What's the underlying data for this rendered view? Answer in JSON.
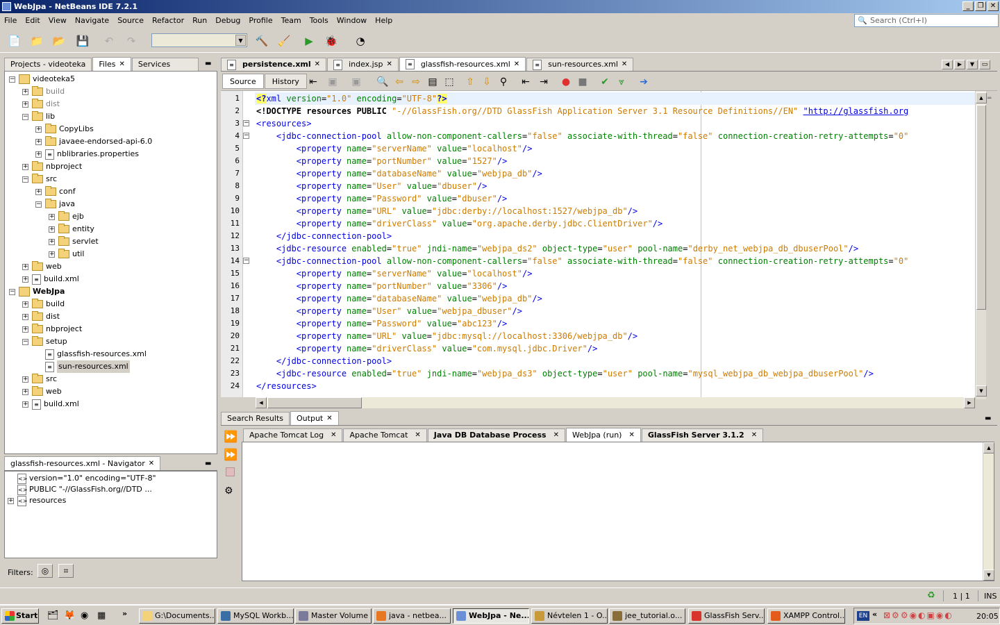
{
  "window": {
    "title": "WebJpa - NetBeans IDE 7.2.1"
  },
  "menu": [
    "File",
    "Edit",
    "View",
    "Navigate",
    "Source",
    "Refactor",
    "Run",
    "Debug",
    "Profile",
    "Team",
    "Tools",
    "Window",
    "Help"
  ],
  "search": {
    "placeholder": "Search (Ctrl+I)"
  },
  "left_tabs": [
    {
      "label": "Projects - videoteka",
      "active": false
    },
    {
      "label": "Files",
      "active": true,
      "closable": true
    },
    {
      "label": "Services",
      "active": false
    }
  ],
  "file_tree": [
    {
      "label": "videoteka5",
      "level": 0,
      "type": "project",
      "expanded": true
    },
    {
      "label": "build",
      "level": 1,
      "type": "folder",
      "gray": true
    },
    {
      "label": "dist",
      "level": 1,
      "type": "folder",
      "gray": true
    },
    {
      "label": "lib",
      "level": 1,
      "type": "folder",
      "expanded": true
    },
    {
      "label": "CopyLibs",
      "level": 2,
      "type": "folder"
    },
    {
      "label": "javaee-endorsed-api-6.0",
      "level": 2,
      "type": "folder"
    },
    {
      "label": "nblibraries.properties",
      "level": 2,
      "type": "file"
    },
    {
      "label": "nbproject",
      "level": 1,
      "type": "folder"
    },
    {
      "label": "src",
      "level": 1,
      "type": "folder",
      "expanded": true
    },
    {
      "label": "conf",
      "level": 2,
      "type": "folder"
    },
    {
      "label": "java",
      "level": 2,
      "type": "folder",
      "expanded": true
    },
    {
      "label": "ejb",
      "level": 3,
      "type": "folder"
    },
    {
      "label": "entity",
      "level": 3,
      "type": "folder"
    },
    {
      "label": "servlet",
      "level": 3,
      "type": "folder"
    },
    {
      "label": "util",
      "level": 3,
      "type": "folder"
    },
    {
      "label": "web",
      "level": 1,
      "type": "folder"
    },
    {
      "label": "build.xml",
      "level": 1,
      "type": "file"
    },
    {
      "label": "WebJpa",
      "level": 0,
      "type": "project",
      "expanded": true,
      "bold": true
    },
    {
      "label": "build",
      "level": 1,
      "type": "folder"
    },
    {
      "label": "dist",
      "level": 1,
      "type": "folder"
    },
    {
      "label": "nbproject",
      "level": 1,
      "type": "folder"
    },
    {
      "label": "setup",
      "level": 1,
      "type": "folder",
      "expanded": true
    },
    {
      "label": "glassfish-resources.xml",
      "level": 2,
      "type": "file",
      "leaf": true
    },
    {
      "label": "sun-resources.xml",
      "level": 2,
      "type": "file",
      "leaf": true,
      "selected": true
    },
    {
      "label": "src",
      "level": 1,
      "type": "folder"
    },
    {
      "label": "web",
      "level": 1,
      "type": "folder"
    },
    {
      "label": "build.xml",
      "level": 1,
      "type": "file"
    }
  ],
  "navigator": {
    "title": "glassfish-resources.xml - Navigator",
    "items": [
      {
        "label": "version=\"1.0\" encoding=\"UTF-8\"",
        "expand": false
      },
      {
        "label": "PUBLIC \"-//GlassFish.org//DTD ...",
        "expand": false
      },
      {
        "label": "resources",
        "expand": true
      }
    ],
    "filters_label": "Filters:"
  },
  "editor_tabs": [
    {
      "label": "persistence.xml",
      "bold": true
    },
    {
      "label": "index.jsp"
    },
    {
      "label": "glassfish-resources.xml",
      "active": true
    },
    {
      "label": "sun-resources.xml"
    }
  ],
  "editor_view_tabs": [
    {
      "label": "Source",
      "active": true
    },
    {
      "label": "History"
    }
  ],
  "code_lines": [
    [
      [
        "pi",
        "<?"
      ],
      [
        "tag",
        "xml "
      ],
      [
        "an",
        "version"
      ],
      [
        "t",
        "="
      ],
      [
        "av",
        "\"1.0\""
      ],
      [
        "t",
        " "
      ],
      [
        "an",
        "encoding"
      ],
      [
        "t",
        "="
      ],
      [
        "av",
        "\"UTF-8\""
      ],
      [
        "pi",
        "?>"
      ]
    ],
    [
      [
        "dt",
        "<!DOCTYPE resources PUBLIC "
      ],
      [
        "av",
        "\"-//GlassFish.org//DTD GlassFish Application Server 3.1 Resource Definitions//EN\""
      ],
      [
        "t",
        " "
      ],
      [
        "av",
        "\"http://glassfish.org"
      ]
    ],
    [
      [
        "tag",
        "<resources>"
      ]
    ],
    [
      [
        "t",
        "    "
      ],
      [
        "tag",
        "<jdbc-connection-pool "
      ],
      [
        "an",
        "allow-non-component-callers"
      ],
      [
        "t",
        "="
      ],
      [
        "av",
        "\"false\""
      ],
      [
        "t",
        " "
      ],
      [
        "an",
        "associate-with-thread"
      ],
      [
        "t",
        "="
      ],
      [
        "av",
        "\"false\""
      ],
      [
        "t",
        " "
      ],
      [
        "an",
        "connection-creation-retry-attempts"
      ],
      [
        "t",
        "="
      ],
      [
        "av",
        "\"0\""
      ]
    ],
    [
      [
        "t",
        "        "
      ],
      [
        "tag",
        "<property "
      ],
      [
        "an",
        "name"
      ],
      [
        "t",
        "="
      ],
      [
        "av",
        "\"serverName\""
      ],
      [
        "t",
        " "
      ],
      [
        "an",
        "value"
      ],
      [
        "t",
        "="
      ],
      [
        "av",
        "\"localhost\""
      ],
      [
        "tag",
        "/>"
      ]
    ],
    [
      [
        "t",
        "        "
      ],
      [
        "tag",
        "<property "
      ],
      [
        "an",
        "name"
      ],
      [
        "t",
        "="
      ],
      [
        "av",
        "\"portNumber\""
      ],
      [
        "t",
        " "
      ],
      [
        "an",
        "value"
      ],
      [
        "t",
        "="
      ],
      [
        "av",
        "\"1527\""
      ],
      [
        "tag",
        "/>"
      ]
    ],
    [
      [
        "t",
        "        "
      ],
      [
        "tag",
        "<property "
      ],
      [
        "an",
        "name"
      ],
      [
        "t",
        "="
      ],
      [
        "av",
        "\"databaseName\""
      ],
      [
        "t",
        " "
      ],
      [
        "an",
        "value"
      ],
      [
        "t",
        "="
      ],
      [
        "av",
        "\"webjpa_db\""
      ],
      [
        "tag",
        "/>"
      ]
    ],
    [
      [
        "t",
        "        "
      ],
      [
        "tag",
        "<property "
      ],
      [
        "an",
        "name"
      ],
      [
        "t",
        "="
      ],
      [
        "av",
        "\"User\""
      ],
      [
        "t",
        " "
      ],
      [
        "an",
        "value"
      ],
      [
        "t",
        "="
      ],
      [
        "av",
        "\"dbuser\""
      ],
      [
        "tag",
        "/>"
      ]
    ],
    [
      [
        "t",
        "        "
      ],
      [
        "tag",
        "<property "
      ],
      [
        "an",
        "name"
      ],
      [
        "t",
        "="
      ],
      [
        "av",
        "\"Password\""
      ],
      [
        "t",
        " "
      ],
      [
        "an",
        "value"
      ],
      [
        "t",
        "="
      ],
      [
        "av",
        "\"dbuser\""
      ],
      [
        "tag",
        "/>"
      ]
    ],
    [
      [
        "t",
        "        "
      ],
      [
        "tag",
        "<property "
      ],
      [
        "an",
        "name"
      ],
      [
        "t",
        "="
      ],
      [
        "av",
        "\"URL\""
      ],
      [
        "t",
        " "
      ],
      [
        "an",
        "value"
      ],
      [
        "t",
        "="
      ],
      [
        "av",
        "\"jdbc:derby://localhost:1527/webjpa_db\""
      ],
      [
        "tag",
        "/>"
      ]
    ],
    [
      [
        "t",
        "        "
      ],
      [
        "tag",
        "<property "
      ],
      [
        "an",
        "name"
      ],
      [
        "t",
        "="
      ],
      [
        "av",
        "\"driverClass\""
      ],
      [
        "t",
        " "
      ],
      [
        "an",
        "value"
      ],
      [
        "t",
        "="
      ],
      [
        "av",
        "\"org.apache.derby.jdbc.ClientDriver\""
      ],
      [
        "tag",
        "/>"
      ]
    ],
    [
      [
        "t",
        "    "
      ],
      [
        "tag",
        "</jdbc-connection-pool>"
      ]
    ],
    [
      [
        "t",
        "    "
      ],
      [
        "tag",
        "<jdbc-resource "
      ],
      [
        "an",
        "enabled"
      ],
      [
        "t",
        "="
      ],
      [
        "av",
        "\"true\""
      ],
      [
        "t",
        " "
      ],
      [
        "an",
        "jndi-name"
      ],
      [
        "t",
        "="
      ],
      [
        "av",
        "\"webjpa_ds2\""
      ],
      [
        "t",
        " "
      ],
      [
        "an",
        "object-type"
      ],
      [
        "t",
        "="
      ],
      [
        "av",
        "\"user\""
      ],
      [
        "t",
        " "
      ],
      [
        "an",
        "pool-name"
      ],
      [
        "t",
        "="
      ],
      [
        "av",
        "\"derby_net_webjpa_db_dbuserPool\""
      ],
      [
        "tag",
        "/>"
      ]
    ],
    [
      [
        "t",
        "    "
      ],
      [
        "tag",
        "<jdbc-connection-pool "
      ],
      [
        "an",
        "allow-non-component-callers"
      ],
      [
        "t",
        "="
      ],
      [
        "av",
        "\"false\""
      ],
      [
        "t",
        " "
      ],
      [
        "an",
        "associate-with-thread"
      ],
      [
        "t",
        "="
      ],
      [
        "av",
        "\"false\""
      ],
      [
        "t",
        " "
      ],
      [
        "an",
        "connection-creation-retry-attempts"
      ],
      [
        "t",
        "="
      ],
      [
        "av",
        "\"0\""
      ]
    ],
    [
      [
        "t",
        "        "
      ],
      [
        "tag",
        "<property "
      ],
      [
        "an",
        "name"
      ],
      [
        "t",
        "="
      ],
      [
        "av",
        "\"serverName\""
      ],
      [
        "t",
        " "
      ],
      [
        "an",
        "value"
      ],
      [
        "t",
        "="
      ],
      [
        "av",
        "\"localhost\""
      ],
      [
        "tag",
        "/>"
      ]
    ],
    [
      [
        "t",
        "        "
      ],
      [
        "tag",
        "<property "
      ],
      [
        "an",
        "name"
      ],
      [
        "t",
        "="
      ],
      [
        "av",
        "\"portNumber\""
      ],
      [
        "t",
        " "
      ],
      [
        "an",
        "value"
      ],
      [
        "t",
        "="
      ],
      [
        "av",
        "\"3306\""
      ],
      [
        "tag",
        "/>"
      ]
    ],
    [
      [
        "t",
        "        "
      ],
      [
        "tag",
        "<property "
      ],
      [
        "an",
        "name"
      ],
      [
        "t",
        "="
      ],
      [
        "av",
        "\"databaseName\""
      ],
      [
        "t",
        " "
      ],
      [
        "an",
        "value"
      ],
      [
        "t",
        "="
      ],
      [
        "av",
        "\"webjpa_db\""
      ],
      [
        "tag",
        "/>"
      ]
    ],
    [
      [
        "t",
        "        "
      ],
      [
        "tag",
        "<property "
      ],
      [
        "an",
        "name"
      ],
      [
        "t",
        "="
      ],
      [
        "av",
        "\"User\""
      ],
      [
        "t",
        " "
      ],
      [
        "an",
        "value"
      ],
      [
        "t",
        "="
      ],
      [
        "av",
        "\"webjpa_dbuser\""
      ],
      [
        "tag",
        "/>"
      ]
    ],
    [
      [
        "t",
        "        "
      ],
      [
        "tag",
        "<property "
      ],
      [
        "an",
        "name"
      ],
      [
        "t",
        "="
      ],
      [
        "av",
        "\"Password\""
      ],
      [
        "t",
        " "
      ],
      [
        "an",
        "value"
      ],
      [
        "t",
        "="
      ],
      [
        "av",
        "\"abc123\""
      ],
      [
        "tag",
        "/>"
      ]
    ],
    [
      [
        "t",
        "        "
      ],
      [
        "tag",
        "<property "
      ],
      [
        "an",
        "name"
      ],
      [
        "t",
        "="
      ],
      [
        "av",
        "\"URL\""
      ],
      [
        "t",
        " "
      ],
      [
        "an",
        "value"
      ],
      [
        "t",
        "="
      ],
      [
        "av",
        "\"jdbc:mysql://localhost:3306/webjpa_db\""
      ],
      [
        "tag",
        "/>"
      ]
    ],
    [
      [
        "t",
        "        "
      ],
      [
        "tag",
        "<property "
      ],
      [
        "an",
        "name"
      ],
      [
        "t",
        "="
      ],
      [
        "av",
        "\"driverClass\""
      ],
      [
        "t",
        " "
      ],
      [
        "an",
        "value"
      ],
      [
        "t",
        "="
      ],
      [
        "av",
        "\"com.mysql.jdbc.Driver\""
      ],
      [
        "tag",
        "/>"
      ]
    ],
    [
      [
        "t",
        "    "
      ],
      [
        "tag",
        "</jdbc-connection-pool>"
      ]
    ],
    [
      [
        "t",
        "    "
      ],
      [
        "tag",
        "<jdbc-resource "
      ],
      [
        "an",
        "enabled"
      ],
      [
        "t",
        "="
      ],
      [
        "av",
        "\"true\""
      ],
      [
        "t",
        " "
      ],
      [
        "an",
        "jndi-name"
      ],
      [
        "t",
        "="
      ],
      [
        "av",
        "\"webjpa_ds3\""
      ],
      [
        "t",
        " "
      ],
      [
        "an",
        "object-type"
      ],
      [
        "t",
        "="
      ],
      [
        "av",
        "\"user\""
      ],
      [
        "t",
        " "
      ],
      [
        "an",
        "pool-name"
      ],
      [
        "t",
        "="
      ],
      [
        "av",
        "\"mysql_webjpa_db_webjpa_dbuserPool\""
      ],
      [
        "tag",
        "/>"
      ]
    ],
    [
      [
        "tag",
        "</resources>"
      ]
    ]
  ],
  "bottom_tabs": [
    {
      "label": "Search Results"
    },
    {
      "label": "Output",
      "active": true,
      "closable": true
    }
  ],
  "output_tabs": [
    {
      "label": "Apache Tomcat Log"
    },
    {
      "label": "Apache Tomcat"
    },
    {
      "label": "Java DB Database Process",
      "bold": true
    },
    {
      "label": "WebJpa (run)",
      "active": true
    },
    {
      "label": "GlassFish Server 3.1.2",
      "bold": true
    }
  ],
  "status": {
    "position": "1 | 1",
    "mode": "INS"
  },
  "taskbar": {
    "start": "Start",
    "tasks": [
      {
        "label": "G:\\Documents...",
        "color": "#f4d27a"
      },
      {
        "label": "MySQL Workb...",
        "color": "#3a6ea5"
      },
      {
        "label": "Master Volume",
        "color": "#7a7a9a"
      },
      {
        "label": "java - netbea...",
        "color": "#e87722"
      },
      {
        "label": "WebJpa - Ne...",
        "color": "#6b8fd6",
        "active": true
      },
      {
        "label": "Névtelen 1 - O...",
        "color": "#c89a3a"
      },
      {
        "label": "jee_tutorial.o...",
        "color": "#8a6e3a"
      },
      {
        "label": "GlassFish Serv...",
        "color": "#d9342b"
      },
      {
        "label": "XAMPP Control...",
        "color": "#e45c1b"
      }
    ],
    "lang": "EN",
    "clock": "20:05"
  },
  "icons": {
    "close": "×",
    "expand": "+",
    "collapse": "−"
  }
}
